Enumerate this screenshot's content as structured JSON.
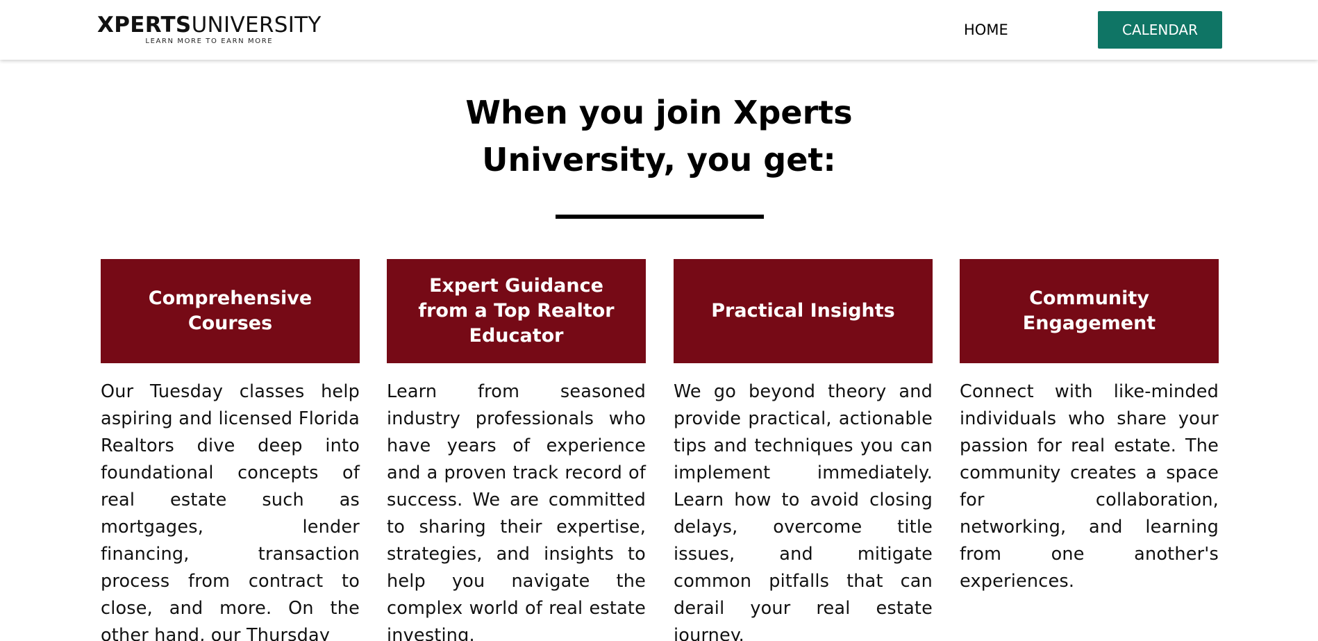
{
  "header": {
    "logo_bold": "XPERTS",
    "logo_light": "UNIVERSITY",
    "logo_tagline": "LEARN MORE TO EARN MORE",
    "nav_home": "HOME",
    "nav_calendar": "CALENDAR"
  },
  "colors": {
    "accent_teal": "#0f7565",
    "card_maroon": "#760a16"
  },
  "section": {
    "heading": "When you join Xperts University, you get:"
  },
  "cards": [
    {
      "title": "Comprehensive Courses",
      "text": "Our Tuesday classes help aspiring and licensed Florida Realtors dive deep into foundational concepts of real estate such as mortgages, lender financing, transaction process from contract to close, and more. On the other hand, our Thursday"
    },
    {
      "title": "Expert Guidance from a Top Realtor Educator",
      "text": "Learn from seasoned industry professionals who have years of experience and a proven track record of success. We are committed to sharing their expertise, strategies, and insights to help you navigate the complex world of real estate investing."
    },
    {
      "title": "Practical Insights",
      "text": "We go beyond theory and provide practical, actionable tips and techniques you can implement immediately. Learn how to avoid closing delays, overcome title issues, and mitigate common pitfalls that can derail your real estate journey."
    },
    {
      "title": "Community Engagement",
      "text": "Connect with like-minded individuals who share your passion for real estate. The community creates a space for collaboration, networking, and learning from one another's experiences."
    }
  ]
}
